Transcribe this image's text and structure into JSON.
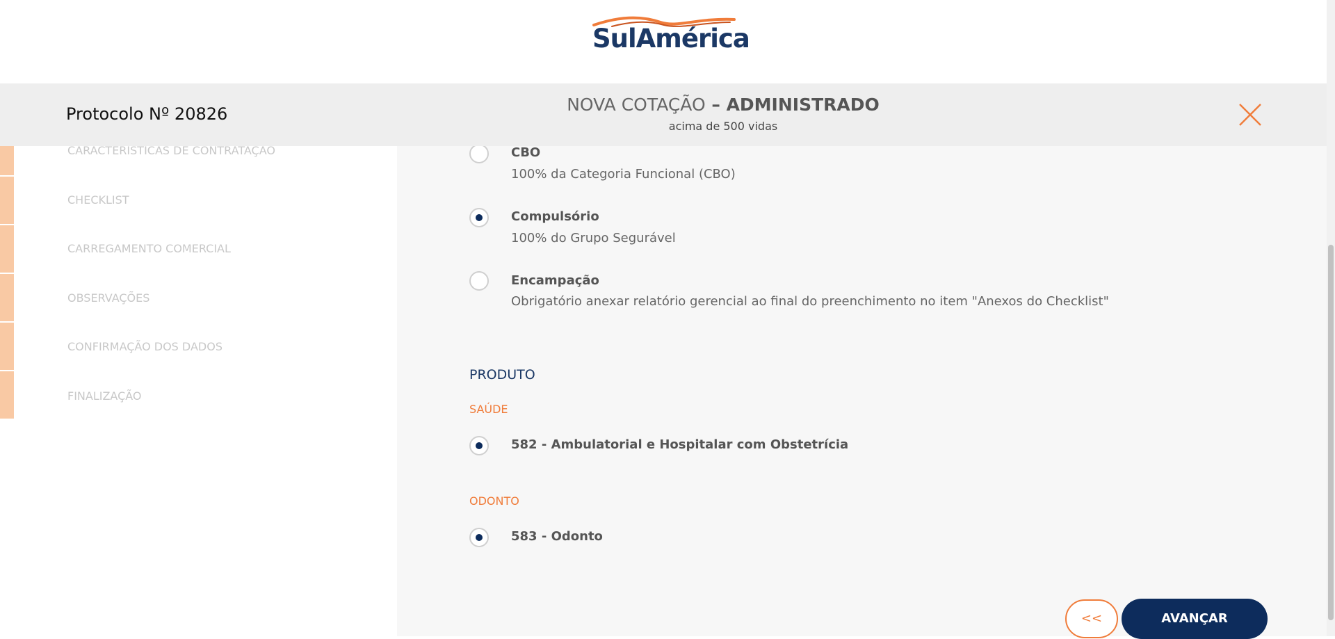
{
  "brand": {
    "logo_text": "SulAmérica",
    "primary_color": "#0d2c5c",
    "accent_color": "#f07c3a"
  },
  "header": {
    "protocol": "Protocolo Nº 20826",
    "title_light": "NOVA COTAÇÃO",
    "title_dash": " – ",
    "title_strong": "ADMINISTRADO",
    "subtitle": "acima de 500 vidas",
    "close_icon": "close-icon"
  },
  "sidebar": {
    "items": [
      {
        "label": "CARACTERÍSTICAS DE CONTRATAÇÃO"
      },
      {
        "label": "CHECKLIST"
      },
      {
        "label": "CARREGAMENTO COMERCIAL"
      },
      {
        "label": "OBSERVAÇÕES"
      },
      {
        "label": "CONFIRMAÇÃO DOS DADOS"
      },
      {
        "label": "FINALIZAÇÃO"
      }
    ]
  },
  "contract_options": [
    {
      "title": "CBO",
      "description": "100% da Categoria Funcional (CBO)",
      "selected": false
    },
    {
      "title": "Compulsório",
      "description": "100% do Grupo Segurável",
      "selected": true
    },
    {
      "title": "Encampação",
      "description": "Obrigatório anexar relatório gerencial ao final do preenchimento no item \"Anexos do Checklist\"",
      "selected": false
    }
  ],
  "produto": {
    "title": "PRODUTO",
    "saude": {
      "label": "SAÚDE",
      "option": "582 - Ambulatorial e Hospitalar com Obstetrícia",
      "selected": true
    },
    "odonto": {
      "label": "ODONTO",
      "option": "583 - Odonto",
      "selected": true
    }
  },
  "actions": {
    "back_label": "<<",
    "next_label": "AVANÇAR"
  }
}
